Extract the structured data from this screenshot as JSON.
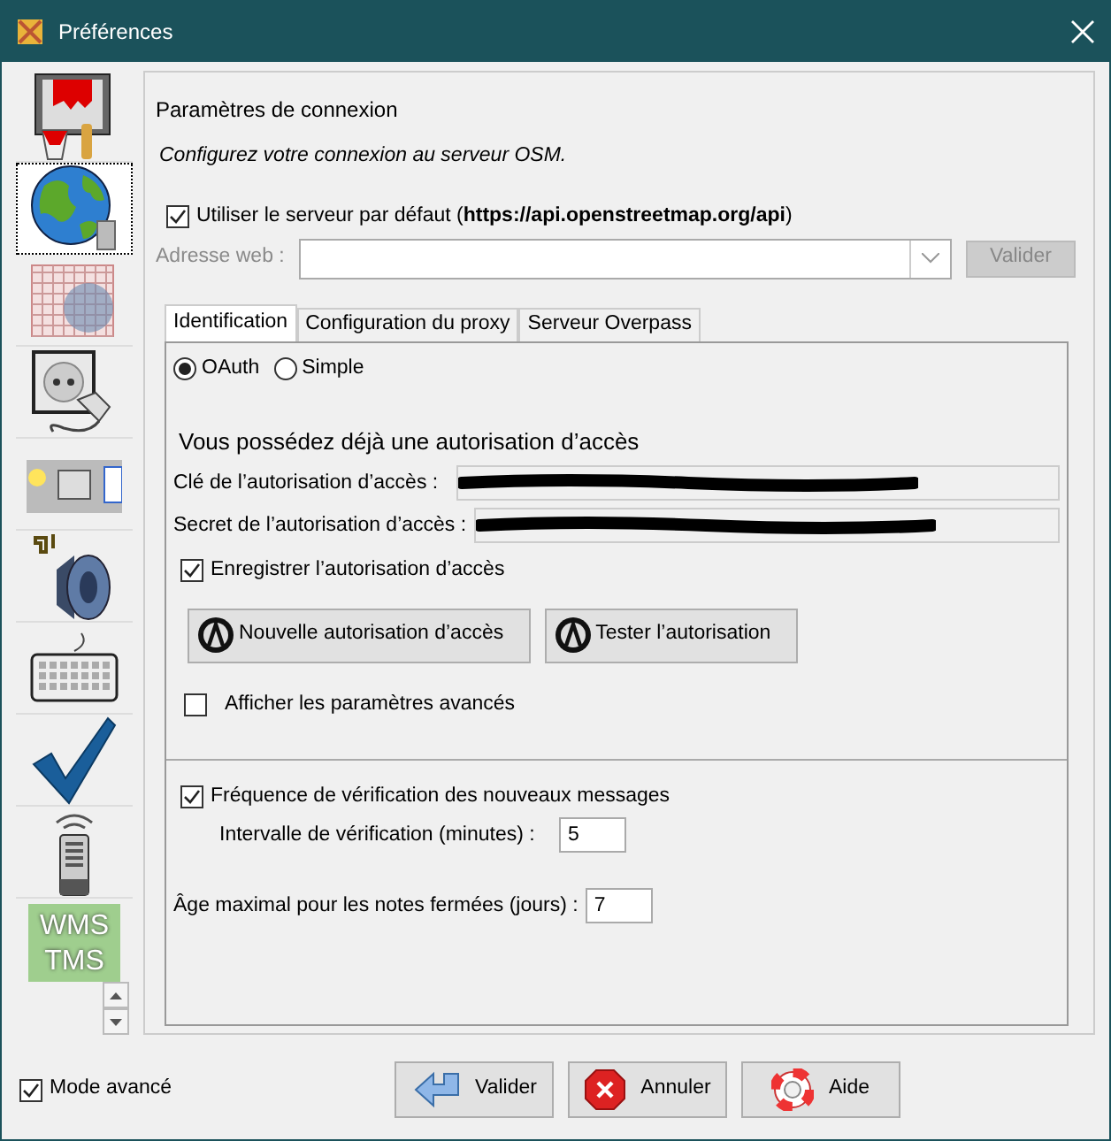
{
  "window": {
    "title": "Préférences"
  },
  "sidebar": {
    "items": [
      {
        "kind": "paint",
        "selected": false
      },
      {
        "kind": "globe",
        "selected": true
      },
      {
        "kind": "grid",
        "selected": false
      },
      {
        "kind": "plug",
        "selected": false
      },
      {
        "kind": "toolbar",
        "selected": false
      },
      {
        "kind": "speaker",
        "selected": false
      },
      {
        "kind": "keyboard",
        "selected": false
      },
      {
        "kind": "check",
        "selected": false
      },
      {
        "kind": "remote",
        "selected": false
      },
      {
        "kind": "wms",
        "selected": false,
        "lines": [
          "WMS",
          "TMS"
        ]
      }
    ]
  },
  "header": {
    "title": "Paramètres de connexion",
    "subtitle": "Configurez votre connexion au serveur OSM."
  },
  "default_server": {
    "checked": true,
    "label": "Utiliser le serveur par défaut (**https://api.openstreetmap.org/api**)"
  },
  "web_address": {
    "label": "Adresse web :",
    "disabled": true
  },
  "validate_button": {
    "label": "Valider",
    "disabled": true
  },
  "tabs": [
    {
      "label": "Identification",
      "selected": true
    },
    {
      "label": "Configuration du proxy",
      "selected": false
    },
    {
      "label": "Serveur Overpass",
      "selected": false
    }
  ],
  "auth_methods": [
    {
      "label": "OAuth",
      "selected": true
    },
    {
      "label": "Simple",
      "selected": false
    }
  ],
  "auth_heading": "Vous possédez déjà une autorisation d’accès",
  "auth_fields": [
    {
      "label": "Clé de l’autorisation d’accès :",
      "redacted": true
    },
    {
      "label": "Secret de l’autorisation d’accès :",
      "redacted": true
    }
  ],
  "save_auth": {
    "checked": true,
    "label": "Enregistrer l’autorisation d’accès"
  },
  "auth_buttons": [
    {
      "label": "Nouvelle autorisation d’accès"
    },
    {
      "label": "Tester l’autorisation"
    }
  ],
  "show_advanced": {
    "checked": false,
    "label": "Afficher les paramètres avancés"
  },
  "message_check": {
    "checked": true,
    "label": "Fréquence de vérification des nouveaux messages"
  },
  "interval": {
    "label": "Intervalle de vérification (minutes) :",
    "value": "5"
  },
  "max_age": {
    "label": "Âge maximal pour les notes fermées (jours) :",
    "value": "7"
  },
  "advanced_mode": {
    "checked": true,
    "label": "Mode avancé"
  },
  "footer_buttons": [
    {
      "kind": "ok",
      "label": "Valider"
    },
    {
      "kind": "cancel",
      "label": "Annuler"
    },
    {
      "kind": "help",
      "label": "Aide"
    }
  ]
}
